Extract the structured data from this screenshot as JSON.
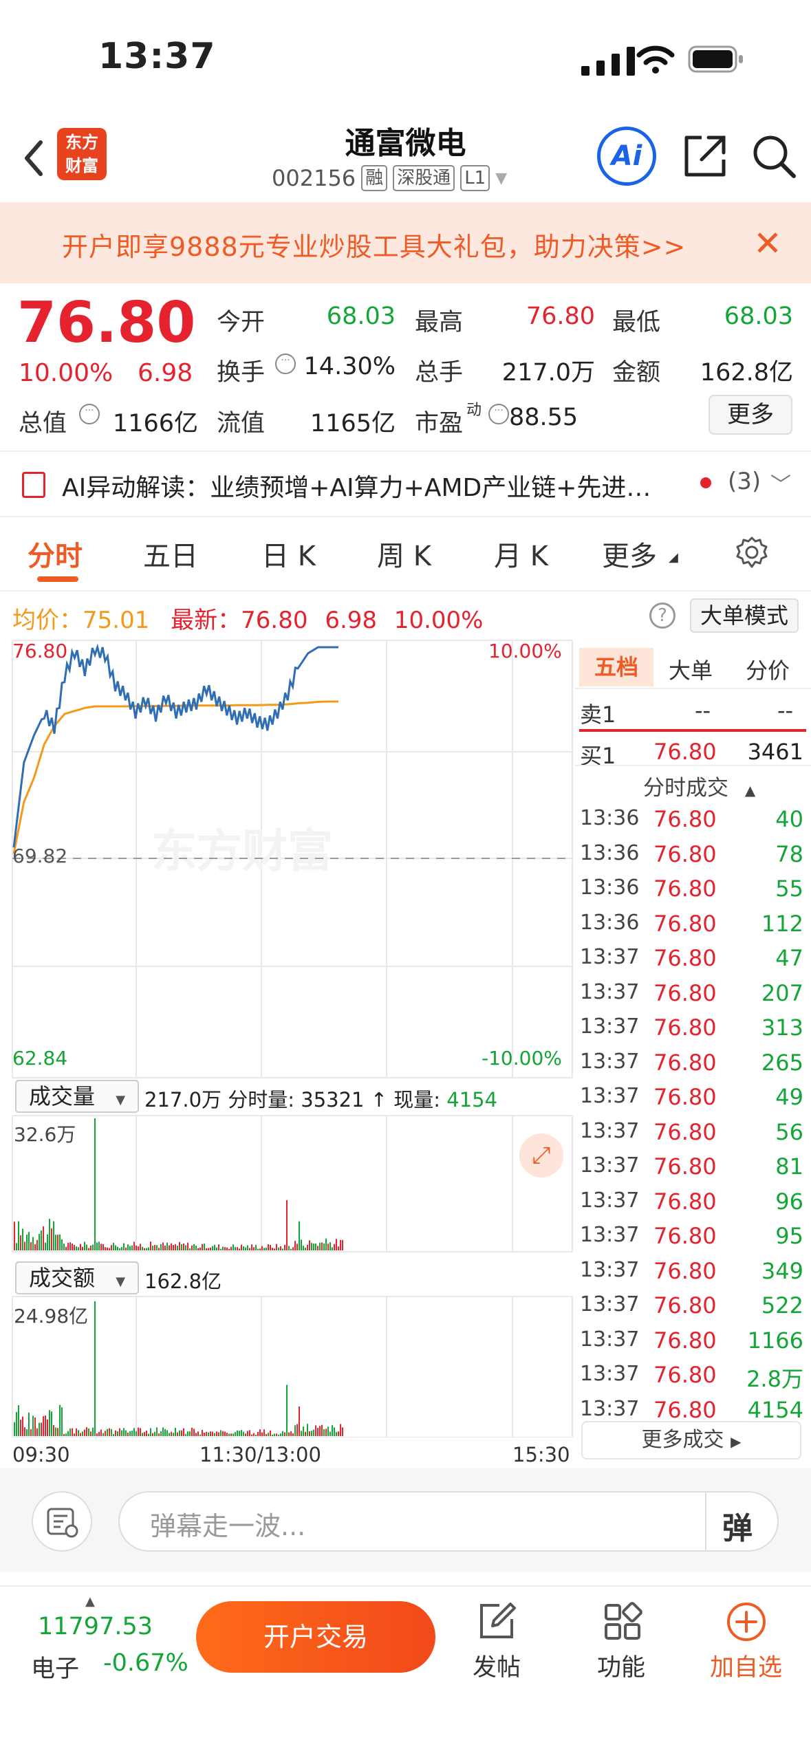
{
  "status": {
    "time": "13:37"
  },
  "header": {
    "stock_name": "通富微电",
    "code": "002156",
    "tags": [
      "融",
      "深股通",
      "L1"
    ],
    "logo_line1": "东方",
    "logo_line2": "财富",
    "ai_label": "Ai"
  },
  "banner": {
    "text": "开户即享9888元专业炒股工具大礼包，助力决策>>"
  },
  "quote": {
    "price": "76.80",
    "pct": "10.00%",
    "change": "6.98",
    "open_label": "今开",
    "open": "68.03",
    "high_label": "最高",
    "high": "76.80",
    "low_label": "最低",
    "low": "68.03",
    "turnover_label": "换手",
    "turnover": "14.30%",
    "vol_label": "总手",
    "vol": "217.0万",
    "amount_label": "金额",
    "amount": "162.8亿",
    "mktcap_label": "总值",
    "mktcap": "1166亿",
    "float_label": "流值",
    "float": "1165亿",
    "pe_label": "市盈",
    "pe_sup": "动",
    "pe": "88.55",
    "more": "更多"
  },
  "ai_row": {
    "text": "AI异动解读：业绩预增+AI算力+AMD产业链+先进…",
    "count": "(3)"
  },
  "tabs": [
    "分时",
    "五日",
    "日 K",
    "周 K",
    "月 K",
    "更多"
  ],
  "info": {
    "avg_label": "均价：",
    "avg": "75.01",
    "latest_label": "最新：",
    "latest": "76.80",
    "chg": "6.98",
    "pct": "10.00%",
    "big_mode": "大单模式"
  },
  "chart": {
    "y_top": "76.80",
    "y_mid": "69.82",
    "y_bottom": "62.84",
    "pct_top": "10.00%",
    "pct_bottom": "-10.00%",
    "watermark": "东方财富",
    "x_labels": [
      "09:30",
      "11:30/13:00",
      "15:30"
    ],
    "vol_label": "成交量",
    "vol_total": "217.0万",
    "vol_detail_label": "分时量:",
    "vol_detail": "35321",
    "vol_now_label": "现量:",
    "vol_now": "4154",
    "vol_max": "32.6万",
    "amt_label": "成交额",
    "amt_total": "162.8亿",
    "amt_max": "24.98亿"
  },
  "chart_data": {
    "type": "line",
    "title": "",
    "ylim": [
      62.84,
      76.8
    ],
    "series": [
      {
        "name": "",
        "values": [
          70.2,
          73.0,
          73.9,
          74.6,
          74.1,
          75.8,
          76.6,
          76.0,
          76.7,
          76.5,
          75.5,
          75.2,
          74.6,
          75.0,
          74.5,
          75.1,
          74.6,
          74.8,
          74.9,
          75.4,
          75.0,
          74.7,
          74.4,
          74.6,
          74.3,
          74.2,
          74.6,
          75.2,
          76.1,
          76.6,
          76.8,
          76.8,
          76.8
        ]
      },
      {
        "name": "",
        "values": [
          70.0,
          71.7,
          72.5,
          73.6,
          74.2,
          74.6,
          74.7,
          74.8,
          74.85,
          74.85,
          74.85,
          74.85,
          74.86,
          74.86,
          74.86,
          74.87,
          74.87,
          74.88,
          74.88,
          74.88,
          74.88,
          74.88,
          74.89,
          74.89,
          74.89,
          74.9,
          74.9,
          74.92,
          74.95,
          74.97,
          75.0,
          75.01,
          75.01
        ]
      }
    ]
  },
  "right_panel": {
    "tabs": [
      "五档",
      "大单",
      "分价"
    ],
    "sell1_label": "卖1",
    "sell1_price": "--",
    "sell1_vol": "--",
    "buy1_label": "买1",
    "buy1_price": "76.80",
    "buy1_vol": "3461",
    "trades_title": "分时成交",
    "trades": [
      {
        "t": "13:36",
        "p": "76.80",
        "v": "40"
      },
      {
        "t": "13:36",
        "p": "76.80",
        "v": "78"
      },
      {
        "t": "13:36",
        "p": "76.80",
        "v": "55"
      },
      {
        "t": "13:36",
        "p": "76.80",
        "v": "112"
      },
      {
        "t": "13:37",
        "p": "76.80",
        "v": "47"
      },
      {
        "t": "13:37",
        "p": "76.80",
        "v": "207"
      },
      {
        "t": "13:37",
        "p": "76.80",
        "v": "313"
      },
      {
        "t": "13:37",
        "p": "76.80",
        "v": "265"
      },
      {
        "t": "13:37",
        "p": "76.80",
        "v": "49"
      },
      {
        "t": "13:37",
        "p": "76.80",
        "v": "56"
      },
      {
        "t": "13:37",
        "p": "76.80",
        "v": "81"
      },
      {
        "t": "13:37",
        "p": "76.80",
        "v": "96"
      },
      {
        "t": "13:37",
        "p": "76.80",
        "v": "95"
      },
      {
        "t": "13:37",
        "p": "76.80",
        "v": "349"
      },
      {
        "t": "13:37",
        "p": "76.80",
        "v": "522"
      },
      {
        "t": "13:37",
        "p": "76.80",
        "v": "1166"
      },
      {
        "t": "13:37",
        "p": "76.80",
        "v": "2.8万"
      },
      {
        "t": "13:37",
        "p": "76.80",
        "v": "4154"
      }
    ],
    "more": "更多成交"
  },
  "danmu": {
    "placeholder": "弹幕走一波...",
    "btn": "弹"
  },
  "bottom": {
    "index_value": "11797.53",
    "index_name": "电子",
    "index_chg": "-0.67%",
    "trade_btn": "开户交易",
    "post": "发帖",
    "func": "功能",
    "add": "加自选"
  },
  "colors": {
    "up": "#e5232f",
    "down": "#14a537",
    "accent": "#ee5b24",
    "line": "#2f6db5",
    "avg": "#f39a1a"
  }
}
